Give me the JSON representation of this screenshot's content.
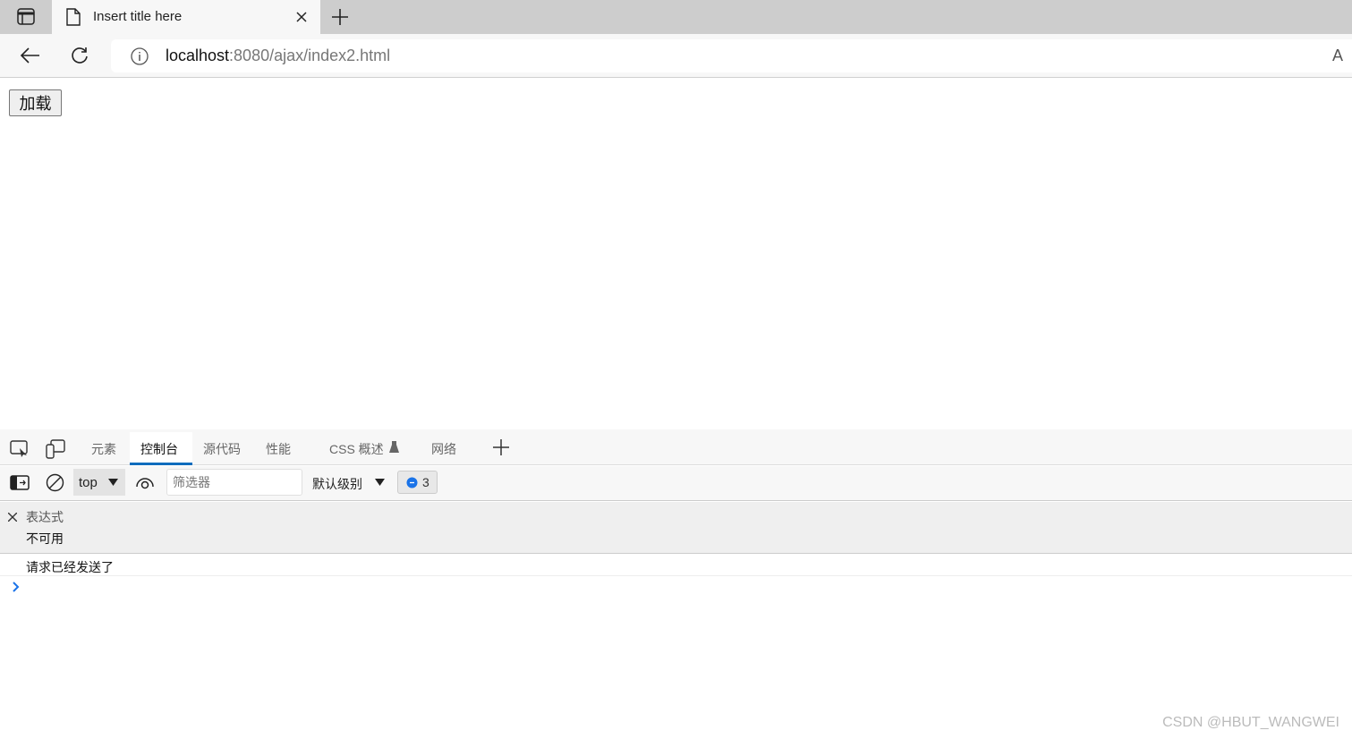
{
  "browser": {
    "tab_title": "Insert title here",
    "url_host": "localhost",
    "url_rest": ":8080/ajax/index2.html"
  },
  "page": {
    "load_button": "加载"
  },
  "devtools": {
    "tabs": [
      "元素",
      "控制台",
      "源代码",
      "性能",
      "CSS 概述",
      "网络"
    ],
    "active_tab": "控制台",
    "context": "top",
    "filter_placeholder": "筛选器",
    "level": "默认级别",
    "issues_count": "3",
    "expression_label": "表达式",
    "expression_value": "不可用",
    "log_messages": [
      "请求已经发送了"
    ]
  },
  "colors": {
    "accent": "#0f6cbd"
  },
  "watermark": "CSDN @HBUT_WANGWEI"
}
